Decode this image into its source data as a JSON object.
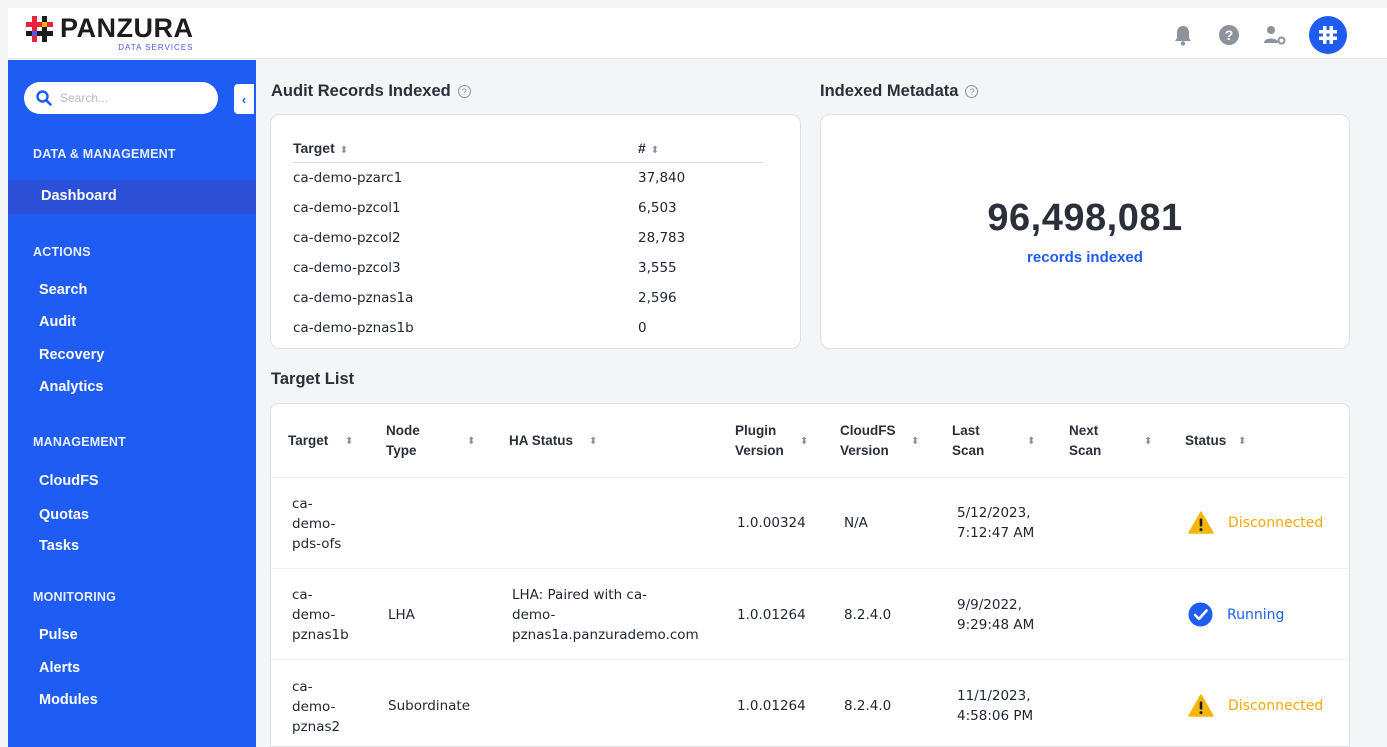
{
  "brand": {
    "name": "PANZURA",
    "sub": "DATA SERVICES"
  },
  "topbar": {
    "icons": [
      "bell-icon",
      "help-icon",
      "user-settings-icon",
      "avatar-logo-icon"
    ]
  },
  "sidebar": {
    "search_placeholder": "Search...",
    "collapse_glyph": "‹",
    "sections": {
      "data_mgmt": "DATA & MANAGEMENT",
      "actions": "ACTIONS",
      "management": "MANAGEMENT",
      "monitoring": "MONITORING"
    },
    "items": {
      "dashboard": "Dashboard",
      "search": "Search",
      "audit": "Audit",
      "recovery": "Recovery",
      "analytics": "Analytics",
      "cloudfs": "CloudFS",
      "quotas": "Quotas",
      "tasks": "Tasks",
      "pulse": "Pulse",
      "alerts": "Alerts",
      "modules": "Modules"
    }
  },
  "audit": {
    "title": "Audit Records Indexed",
    "col_target": "Target",
    "col_count": "#",
    "rows": [
      {
        "target": "ca-demo-pzarc1",
        "count": "37,840"
      },
      {
        "target": "ca-demo-pzcol1",
        "count": "6,503"
      },
      {
        "target": "ca-demo-pzcol2",
        "count": "28,783"
      },
      {
        "target": "ca-demo-pzcol3",
        "count": "3,555"
      },
      {
        "target": "ca-demo-pznas1a",
        "count": "2,596"
      },
      {
        "target": "ca-demo-pznas1b",
        "count": "0"
      }
    ]
  },
  "metadata": {
    "title": "Indexed Metadata",
    "value": "96,498,081",
    "caption": "records indexed"
  },
  "target_list": {
    "title": "Target List",
    "headers": {
      "target": "Target",
      "node_type": "Node\nType",
      "ha_status": "HA Status",
      "plugin": "Plugin\nVersion",
      "cloudfs": "CloudFS\nVersion",
      "last_scan": "Last\nScan",
      "next_scan": "Next\nScan",
      "status": "Status"
    },
    "rows": [
      {
        "target": "ca-\ndemo-\npds-ofs",
        "node_type": "",
        "ha_status": "",
        "plugin": "1.0.00324",
        "cloudfs": "N/A",
        "last_scan": "5/12/2023,\n7:12:47 AM",
        "next_scan": "",
        "status": "Disconnected",
        "status_kind": "warning"
      },
      {
        "target": "ca-\ndemo-\npznas1b",
        "node_type": "LHA",
        "ha_status": "LHA: Paired with ca-\ndemo-\npznas1a.panzurademo.com",
        "plugin": "1.0.01264",
        "cloudfs": "8.2.4.0",
        "last_scan": "9/9/2022,\n9:29:48 AM",
        "next_scan": "",
        "status": "Running",
        "status_kind": "ok"
      },
      {
        "target": "ca-\ndemo-\npznas2",
        "node_type": "Subordinate",
        "ha_status": "",
        "plugin": "1.0.01264",
        "cloudfs": "8.2.4.0",
        "last_scan": "11/1/2023,\n4:58:06 PM",
        "next_scan": "",
        "status": "Disconnected",
        "status_kind": "warning"
      }
    ]
  },
  "colors": {
    "sidebar": "#1e5cf4",
    "accent": "#1f5cf0",
    "warning": "#f5a70a"
  }
}
